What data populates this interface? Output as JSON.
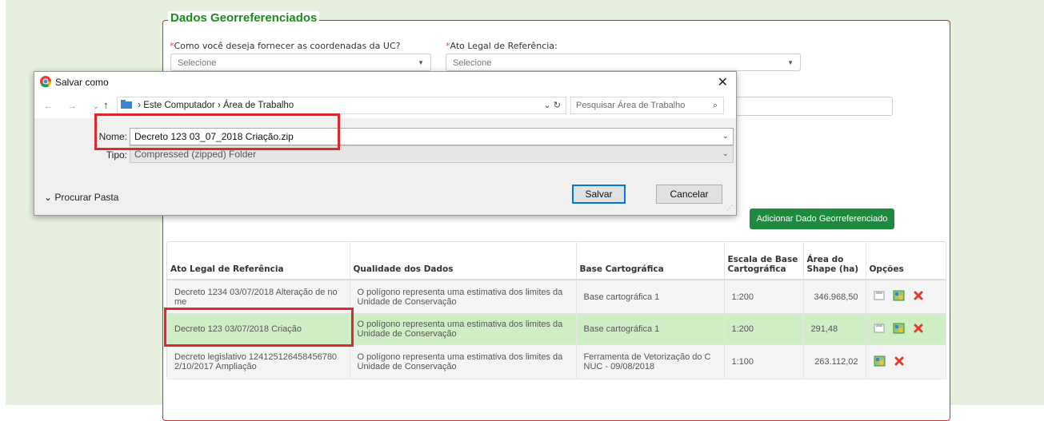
{
  "form": {
    "legend": "Dados Georreferenciados",
    "q_coords_label": "Como você deseja fornecer as coordenadas da UC?",
    "q_coords_value": "Selecione",
    "ato_label": "Ato Legal de Referência:",
    "ato_value": "Selecione",
    "required_mark": "*",
    "add_button": "Adicionar Dado Georreferenciado"
  },
  "table": {
    "headers": [
      "Ato Legal de Referência",
      "Qualidade dos Dados",
      "Base Cartográfica",
      "Escala de Base Cartográfica",
      "Área do Shape (ha)",
      "Opções"
    ],
    "rows": [
      {
        "ato": "Decreto 1234 03/07/2018 Alteração de no me",
        "qualidade": "O polígono representa uma estimativa dos limites da Unidade de Conservação",
        "base": "Base cartográfica 1",
        "escala": "1:200",
        "area": "346.968,50",
        "options": [
          "save-icon",
          "map-icon",
          "delete-icon"
        ]
      },
      {
        "ato": "Decreto 123 03/07/2018 Criação",
        "qualidade": "O polígono representa uma estimativa dos limites da Unidade de Conservação",
        "base": "Base cartográfica 1",
        "escala": "1:200",
        "area": "291,48",
        "options": [
          "save-icon",
          "map-icon",
          "delete-icon"
        ]
      },
      {
        "ato": "Decreto legislativo 124125126458456780 2/10/2017 Ampliação",
        "qualidade": "O polígono representa uma estimativa dos limites da Unidade de Conservação",
        "base": "Ferramenta de Vetorização do C NUC - 09/08/2018",
        "escala": "1:100",
        "area": "263.112,02",
        "options": [
          "map-icon",
          "delete-icon"
        ]
      }
    ]
  },
  "dialog": {
    "title": "Salvar como",
    "close": "✕",
    "path": [
      "Este Computador",
      "Área de Trabalho"
    ],
    "search_placeholder": "Pesquisar Área de Trabalho",
    "name_label": "Nome:",
    "name_value": "Decreto 123 03_07_2018 Criação.zip",
    "type_label": "Tipo:",
    "type_value": "Compressed (zipped) Folder",
    "browse_label": "Procurar Pasta",
    "save_button": "Salvar",
    "cancel_button": "Cancelar"
  },
  "colors": {
    "accent_green": "#1d8a3d",
    "highlight_red": "#e0262e",
    "selected_row": "#cfeec6"
  }
}
